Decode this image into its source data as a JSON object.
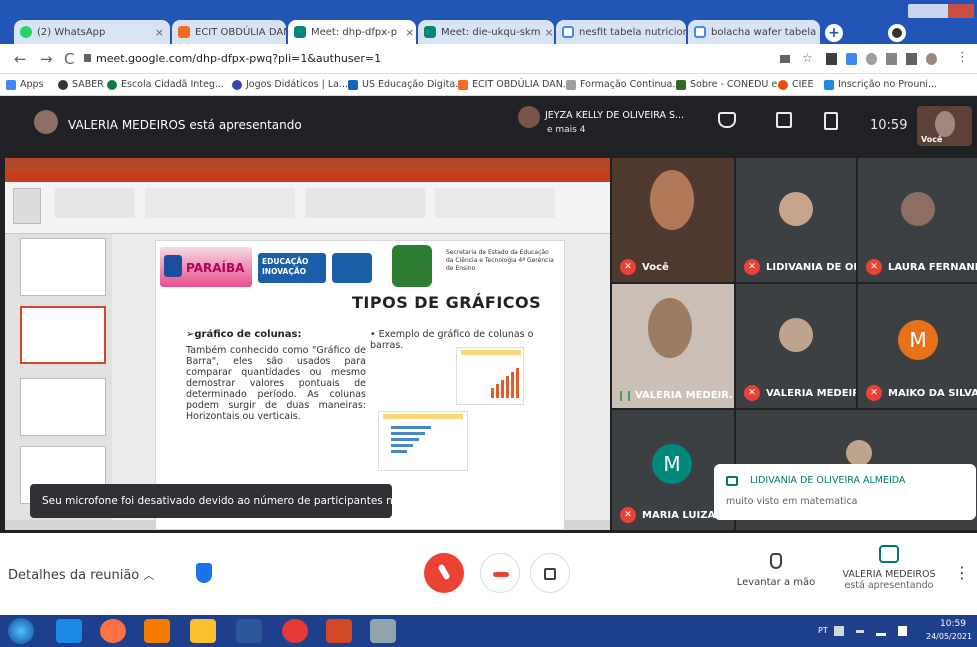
{
  "tabs": [
    {
      "label": "(2) WhatsApp",
      "color": "#25d366"
    },
    {
      "label": "ECIT OBDÚLIA DANTA",
      "color": "#f36c21"
    },
    {
      "label": "Meet: dhp-dfpx-p",
      "color": "#00897b"
    },
    {
      "label": "Meet: die-ukqu-skm",
      "color": "#00897b"
    },
    {
      "label": "nesfit tabela nutriciona",
      "color": "#4285f4"
    },
    {
      "label": "bolacha wafer tabela n",
      "color": "#4285f4"
    }
  ],
  "tab_close": "×",
  "address": {
    "url": "meet.google.com/dhp-dfpx-pwq?pli=1&authuser=1"
  },
  "bookmarks": [
    {
      "label": "Apps",
      "color": "#4285f4"
    },
    {
      "label": "SABER",
      "color": "#333"
    },
    {
      "label": "Escola Cidadã Integ...",
      "color": "#0b8043"
    },
    {
      "label": "Jogos Didáticos | La...",
      "color": "#3949ab"
    },
    {
      "label": "US Educação Digita...",
      "color": "#1565c0"
    },
    {
      "label": "ECIT OBDÚLIA DAN...",
      "color": "#f36c21"
    },
    {
      "label": "Formação Continua...",
      "color": "#9e9e9e"
    },
    {
      "label": "Sobre - CONEDU e...",
      "color": "#33691e"
    },
    {
      "label": "CIEE",
      "color": "#e65100"
    },
    {
      "label": "Inscrição no Prouni...",
      "color": "#1e88e5"
    }
  ],
  "meet": {
    "presenter_text": "VALERIA MEDEIROS está apresentando",
    "top_participant": "JEYZA KELLY DE OLIVEIRA S...",
    "top_more": "e mais 4",
    "time": "10:59",
    "you_label": "Você"
  },
  "slide": {
    "title": "TIPOS DE GRÁFICOS",
    "heading": "gráfico de colunas:",
    "body": "Também conhecido como \"Gráfico de Barra\", eles são usados para comparar quantidades ou mesmo demostrar valores pontuais de determinado período. As colunas podem surgir de duas maneiras: Horizontais ou verticais.",
    "bullet": "Exemplo de gráfico de colunas o barras.",
    "logo_left": "PARAÍBA",
    "logo_mid": "EDUCAÇÃO INOVAÇÃO",
    "secretaria": "Secretaria de Estado da Educação da Ciência e Tecnologia 4ª Gerência de Ensino"
  },
  "participants": [
    {
      "name": "Você",
      "muted": true
    },
    {
      "name": "LIDIVANIA DE OLI...",
      "muted": true
    },
    {
      "name": "LAURA FERNAND...",
      "muted": true
    },
    {
      "name": "VALERIA MEDEIR...",
      "muted": false
    },
    {
      "name": "VALERIA MEDEIR...",
      "muted": true
    },
    {
      "name": "MAIKO DA SILVA ...",
      "muted": true,
      "initial": "M"
    },
    {
      "name": "MARIA LUIZA VI",
      "muted": true,
      "initial": "M"
    }
  ],
  "toast": "Seu microfone foi desativado devido ao número de participantes na chamada",
  "chat": {
    "sender": "LIDIVANIA DE OLIVEIRA ALMEIDA",
    "message": "muito visto em matematica"
  },
  "bottom": {
    "details": "Detalhes da reunião",
    "raise_hand": "Levantar a mão",
    "presenter_name": "VALERIA MEDEIROS",
    "presenting": "está apresentando"
  },
  "taskbar": {
    "time": "10:59",
    "date": "24/05/2021",
    "lang": "PT"
  }
}
